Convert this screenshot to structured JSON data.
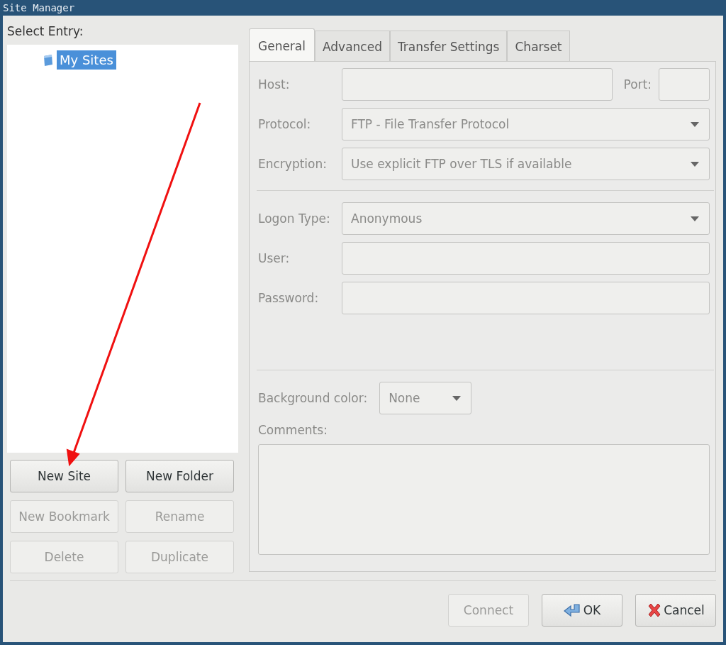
{
  "window": {
    "title": "Site Manager"
  },
  "select_entry_label": "Select Entry:",
  "tree": [
    {
      "label": "My Sites",
      "selected": true
    }
  ],
  "left_buttons": [
    {
      "label": "New Site",
      "disabled": false
    },
    {
      "label": "New Folder",
      "disabled": false
    },
    {
      "label": "New Bookmark",
      "disabled": true
    },
    {
      "label": "Rename",
      "disabled": true
    },
    {
      "label": "Delete",
      "disabled": true
    },
    {
      "label": "Duplicate",
      "disabled": true
    }
  ],
  "tabs": [
    {
      "label": "General",
      "selected": true
    },
    {
      "label": "Advanced",
      "selected": false
    },
    {
      "label": "Transfer Settings",
      "selected": false
    },
    {
      "label": "Charset",
      "selected": false
    }
  ],
  "general": {
    "disabled": true,
    "host": {
      "label": "Host:"
    },
    "port": {
      "label": "Port:"
    },
    "protocol": {
      "label": "Protocol:",
      "value": "FTP - File Transfer Protocol"
    },
    "encryption": {
      "label": "Encryption:",
      "value": "Use explicit FTP over TLS if available"
    },
    "logon_type": {
      "label": "Logon Type:",
      "value": "Anonymous"
    },
    "user": {
      "label": "User:"
    },
    "password": {
      "label": "Password:"
    },
    "background_color": {
      "label": "Background color:",
      "value": "None"
    },
    "comments": {
      "label": "Comments:"
    }
  },
  "footer_buttons": [
    {
      "kind": "plain",
      "label": "Connect",
      "disabled": true
    },
    {
      "kind": "ok",
      "label": "OK",
      "disabled": false
    },
    {
      "kind": "cancel",
      "label": "Cancel",
      "disabled": false
    }
  ]
}
